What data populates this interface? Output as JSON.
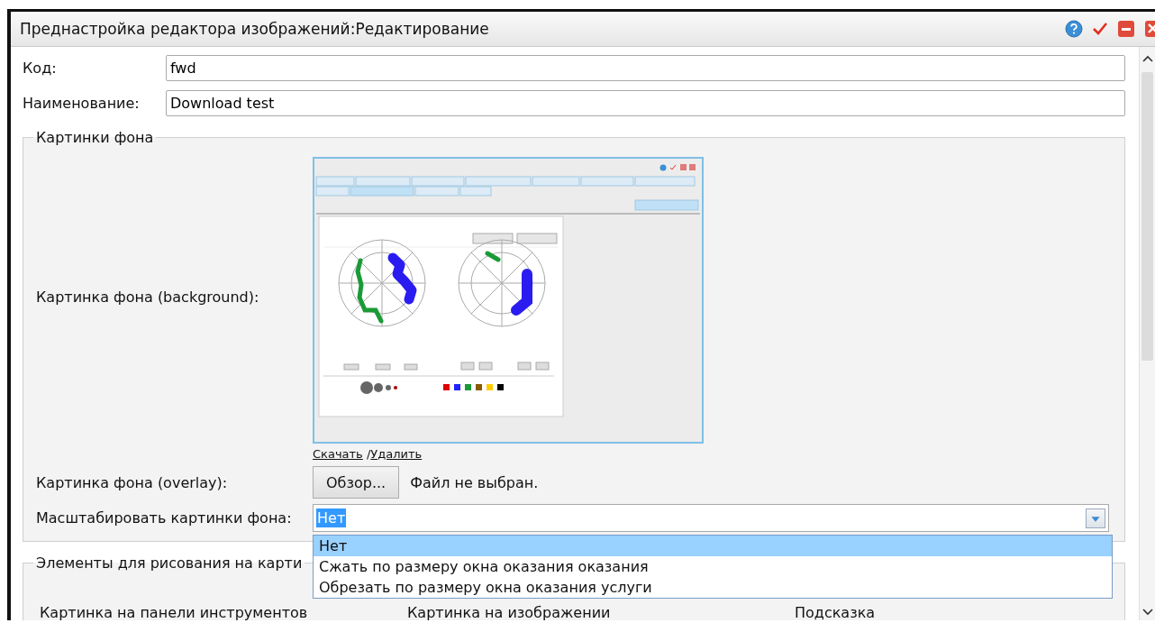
{
  "window": {
    "title": "Преднастройка редактора изображений:Редактирование"
  },
  "fields": [
    {
      "label": "Код:",
      "value": "fwd"
    },
    {
      "label": "Наименование:",
      "value": "Download test"
    }
  ],
  "background_section": {
    "legend": "Картинки фона",
    "background_label": "Картинка фона (background):",
    "links": [
      "Скачать",
      "Удалить"
    ],
    "link_separator": "/",
    "overlay_label": "Картинка фона (overlay):",
    "browse_button": "Обзор...",
    "file_status": "Файл не выбран.",
    "scale_label": "Масштабировать картинки фона:",
    "scale_value": "Нет",
    "dropdown": {
      "expanded": true,
      "options": [
        {
          "label": "Нет",
          "selected": true
        },
        {
          "label": "Сжать по размеру окна оказания оказания",
          "selected": false
        },
        {
          "label": "Обрезать по размеру окна оказания услуги",
          "selected": false
        }
      ]
    }
  },
  "drawing_section": {
    "legend": "Элементы для рисования на карти",
    "columns": [
      "Картинка на панели инструментов",
      "Картинка на изображении",
      "Подсказка"
    ]
  }
}
